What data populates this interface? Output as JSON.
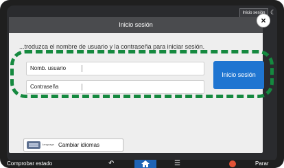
{
  "topbar": {
    "login_button": "Inicio sesión",
    "theme_icon": "moon-icon"
  },
  "dialog": {
    "title": "Inicio sesión",
    "close_icon": "close-icon",
    "instruction": "...troduzca el nombre de usuario y la contraseña para iniciar sesión.",
    "username_label": "Nomb. usuario",
    "username_value": "",
    "password_label": "Contraseña",
    "password_value": "",
    "login_button": "Inicio sesión",
    "change_language_small": "Language",
    "change_language": "Cambiar idiomas"
  },
  "bottombar": {
    "check_status": "Comprobar estado",
    "back_icon": "back-arrow-icon",
    "home_icon": "home-icon",
    "menu_icon": "menu-icon",
    "stop_icon": "stop-icon",
    "stop_label": "Parar"
  },
  "colors": {
    "accent_blue": "#1f75d1",
    "highlight_green": "#15893f",
    "stop_red": "#e25235"
  }
}
